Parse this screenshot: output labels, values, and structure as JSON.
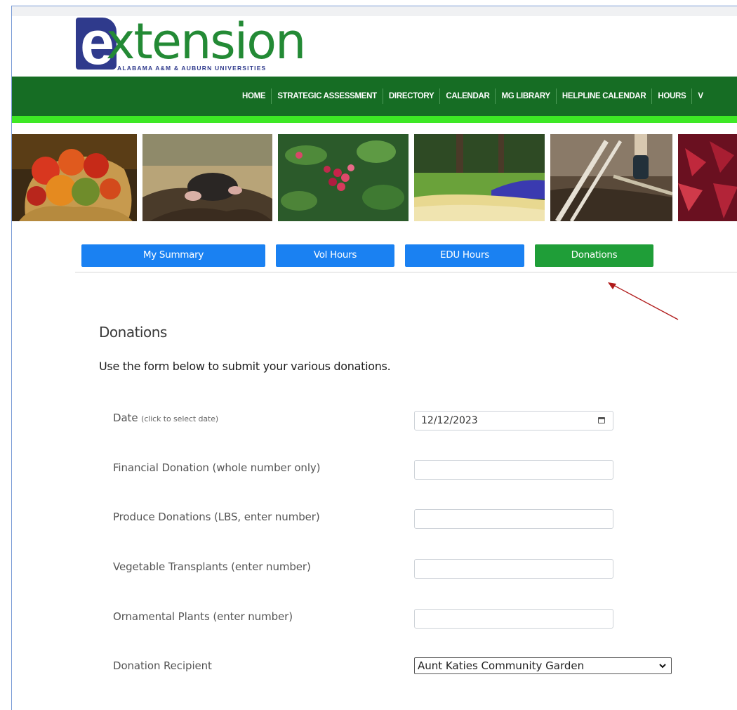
{
  "logo": {
    "letter": "e",
    "word": "xtension",
    "subtitle": "ALABAMA A&M & AUBURN UNIVERSITIES"
  },
  "nav": {
    "items": [
      "HOME",
      "STRATEGIC ASSESSMENT",
      "DIRECTORY",
      "CALENDAR",
      "MG LIBRARY",
      "HELPLINE CALENDAR",
      "HOURS",
      "V"
    ]
  },
  "tabs": [
    {
      "label": "My Summary",
      "color": "#1a81f2"
    },
    {
      "label": "Vol Hours",
      "color": "#1a81f2"
    },
    {
      "label": "EDU Hours",
      "color": "#1a81f2"
    },
    {
      "label": "Donations",
      "color": "#1f9e38",
      "active": true
    }
  ],
  "page": {
    "title": "Donations",
    "intro": "Use the form below to submit your various donations."
  },
  "form": {
    "date_label": "Date",
    "date_hint": "(click to select date)",
    "date_value": "12/12/2023",
    "financial_label": "Financial Donation (whole number only)",
    "financial_value": "",
    "produce_label": "Produce Donations (LBS, enter number)",
    "produce_value": "",
    "veg_label": "Vegetable Transplants (enter number)",
    "veg_value": "",
    "ornamental_label": "Ornamental Plants (enter number)",
    "ornamental_value": "",
    "recipient_label": "Donation Recipient",
    "recipient_value": "Aunt Katies Community Garden"
  },
  "colors": {
    "nav_green": "#166d24",
    "accent_lime": "#3ee825",
    "brand_blue": "#2f3a8c",
    "annotation_arrow": "#b01a1a"
  }
}
